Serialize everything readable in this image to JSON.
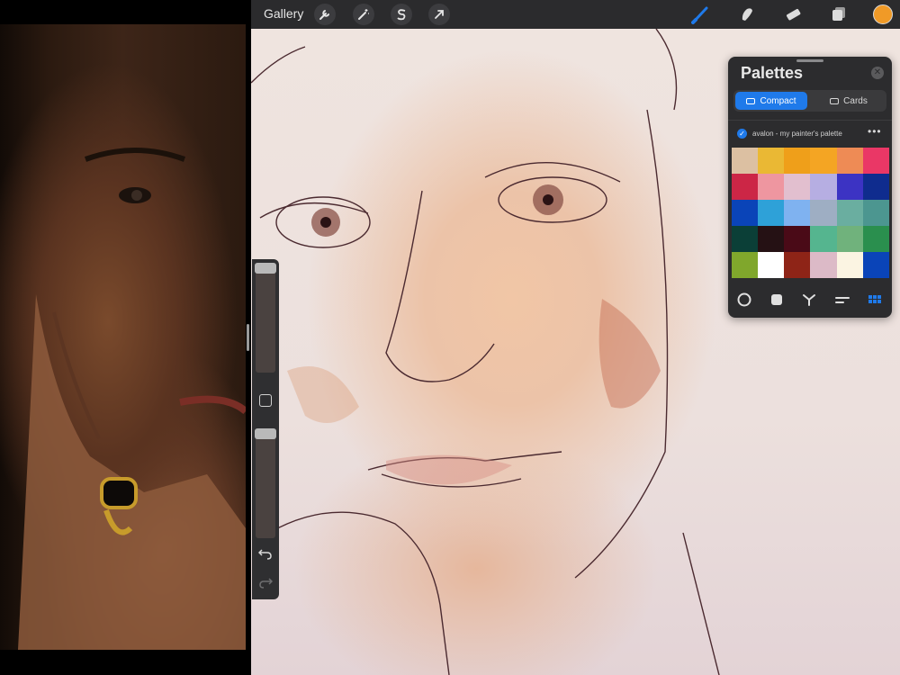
{
  "app": {
    "gallery_label": "Gallery"
  },
  "toolbar": {
    "left_icons": [
      "wrench-icon",
      "magic-wand-icon",
      "selection-s-icon",
      "transform-arrow-icon"
    ],
    "right_icons": [
      "brush-icon",
      "smudge-icon",
      "eraser-icon",
      "layers-icon"
    ],
    "active_tool": "brush-icon",
    "active_tool_color": "#1f7aea",
    "current_color": "#f09a27"
  },
  "sidebar": {
    "brush_size_level": 0.0,
    "opacity_level": 0.0,
    "icons": [
      "modify-square-icon",
      "undo-icon",
      "redo-icon"
    ]
  },
  "palettes": {
    "title": "Palettes",
    "close_icon": "close-icon",
    "view_modes": [
      {
        "label": "Compact",
        "selected": true
      },
      {
        "label": "Cards",
        "selected": false
      }
    ],
    "palette_name": "avalon - my painter's palette",
    "palette_default": true,
    "more_icon": "more-dots-icon",
    "swatches": [
      "#dcc0a2",
      "#eab834",
      "#ef9f1a",
      "#f4a523",
      "#ee8b55",
      "#ea3766",
      "#cc2646",
      "#ee96a0",
      "#e2bfcf",
      "#b6aee2",
      "#3c33c3",
      "#0f2c8e",
      "#0a44b8",
      "#2ea1d8",
      "#7fb2f0",
      "#9eaec3",
      "#6aaea0",
      "#4c9690",
      "#0b3f37",
      "#251114",
      "#4a0a17",
      "#55b58f",
      "#70b27c",
      "#2a8f4e",
      "#80a72c",
      "#ffffff",
      "#8e2417",
      "#dcbac7",
      "#fbf4e2",
      "#0a44b8"
    ],
    "bottom_icons": [
      "circle-icon",
      "square-icon",
      "eyedropper-icon",
      "slider-icon",
      "grid-icon"
    ],
    "active_bottom_icon": "grid-icon"
  }
}
